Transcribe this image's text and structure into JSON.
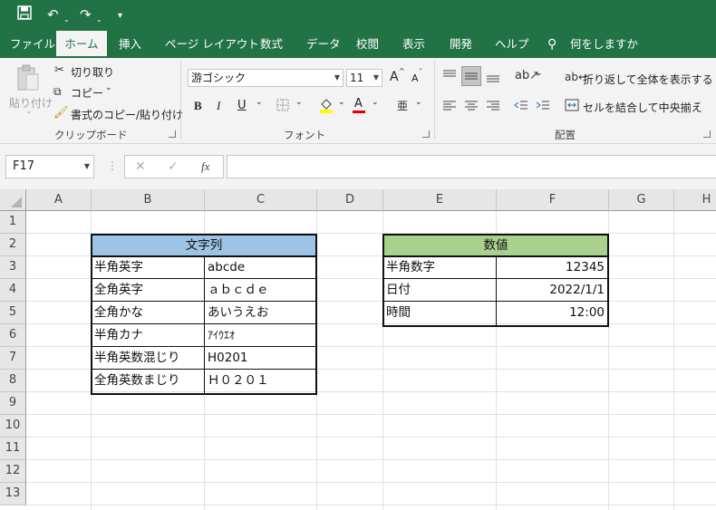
{
  "quick_access": {
    "save_icon": "save-icon",
    "undo_icon": "undo-icon",
    "redo_icon": "redo-icon",
    "customize_icon": "customize-qat-icon"
  },
  "tabs": [
    "ファイル",
    "ホーム",
    "挿入",
    "ページ レイアウト",
    "数式",
    "データ",
    "校閲",
    "表示",
    "開発",
    "ヘルプ"
  ],
  "active_tab": "ホーム",
  "tell_me": "何をしますか",
  "clipboard": {
    "paste": "貼り付け",
    "cut": "切り取り",
    "copy": "コピー",
    "format_painter": "書式のコピー/貼り付け",
    "group_label": "クリップボード"
  },
  "font": {
    "name": "游ゴシック",
    "size": "11",
    "grow": "A",
    "shrink": "A",
    "bold": "B",
    "italic": "I",
    "underline": "U",
    "color_letter": "A",
    "group_label": "フォント"
  },
  "alignment": {
    "wrap_text": "折り返して全体を表示する",
    "merge_center": "セルを結合して中央揃え",
    "group_label": "配置"
  },
  "formula_bar": {
    "name_box": "F17",
    "fx": "fx",
    "cancel": "✕",
    "enter": "✓",
    "value": ""
  },
  "columns": [
    "A",
    "B",
    "C",
    "D",
    "E",
    "F",
    "G",
    "H"
  ],
  "rows": [
    "1",
    "2",
    "3",
    "4",
    "5",
    "6",
    "7",
    "8",
    "9",
    "10",
    "11",
    "12",
    "13"
  ],
  "table_text": {
    "header": "文字列",
    "header_color": "#9dc3e6",
    "rows": [
      {
        "label": "半角英字",
        "value": "abcde"
      },
      {
        "label": "全角英字",
        "value": "ａｂｃｄｅ"
      },
      {
        "label": "全角かな",
        "value": "あいうえお"
      },
      {
        "label": "半角カナ",
        "value": "ｱｲｳｴｵ"
      },
      {
        "label": "半角英数混じり",
        "value": "H0201"
      },
      {
        "label": "全角英数まじり",
        "value": "Ｈ０２０１"
      }
    ]
  },
  "table_number": {
    "header": "数値",
    "header_color": "#a9d18e",
    "rows": [
      {
        "label": "半角数字",
        "value": "12345"
      },
      {
        "label": "日付",
        "value": "2022/1/1"
      },
      {
        "label": "時間",
        "value": "12:00"
      }
    ]
  },
  "colors": {
    "excel_green": "#217346",
    "ribbon_bg": "#f3f3f3"
  }
}
